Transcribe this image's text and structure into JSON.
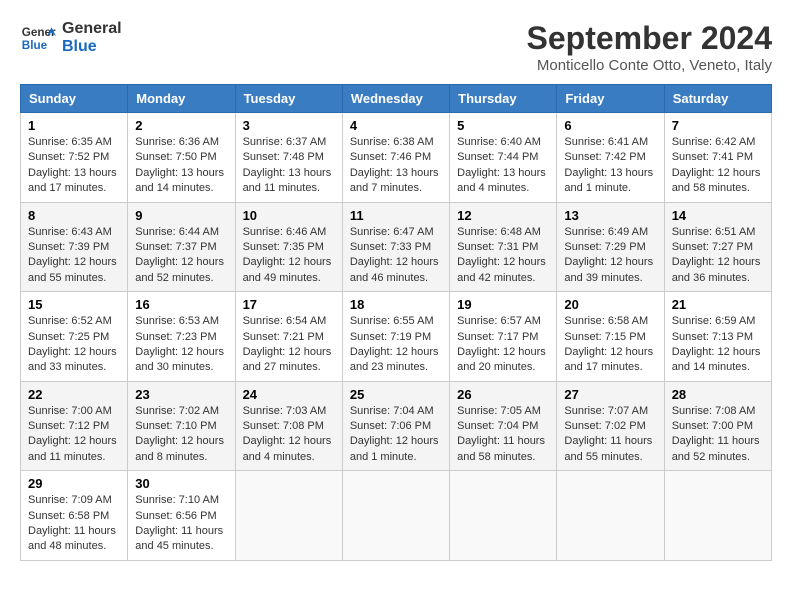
{
  "header": {
    "logo_line1": "General",
    "logo_line2": "Blue",
    "month": "September 2024",
    "location": "Monticello Conte Otto, Veneto, Italy"
  },
  "days_of_week": [
    "Sunday",
    "Monday",
    "Tuesday",
    "Wednesday",
    "Thursday",
    "Friday",
    "Saturday"
  ],
  "weeks": [
    [
      {
        "day": "1",
        "info": "Sunrise: 6:35 AM\nSunset: 7:52 PM\nDaylight: 13 hours and 17 minutes."
      },
      {
        "day": "2",
        "info": "Sunrise: 6:36 AM\nSunset: 7:50 PM\nDaylight: 13 hours and 14 minutes."
      },
      {
        "day": "3",
        "info": "Sunrise: 6:37 AM\nSunset: 7:48 PM\nDaylight: 13 hours and 11 minutes."
      },
      {
        "day": "4",
        "info": "Sunrise: 6:38 AM\nSunset: 7:46 PM\nDaylight: 13 hours and 7 minutes."
      },
      {
        "day": "5",
        "info": "Sunrise: 6:40 AM\nSunset: 7:44 PM\nDaylight: 13 hours and 4 minutes."
      },
      {
        "day": "6",
        "info": "Sunrise: 6:41 AM\nSunset: 7:42 PM\nDaylight: 13 hours and 1 minute."
      },
      {
        "day": "7",
        "info": "Sunrise: 6:42 AM\nSunset: 7:41 PM\nDaylight: 12 hours and 58 minutes."
      }
    ],
    [
      {
        "day": "8",
        "info": "Sunrise: 6:43 AM\nSunset: 7:39 PM\nDaylight: 12 hours and 55 minutes."
      },
      {
        "day": "9",
        "info": "Sunrise: 6:44 AM\nSunset: 7:37 PM\nDaylight: 12 hours and 52 minutes."
      },
      {
        "day": "10",
        "info": "Sunrise: 6:46 AM\nSunset: 7:35 PM\nDaylight: 12 hours and 49 minutes."
      },
      {
        "day": "11",
        "info": "Sunrise: 6:47 AM\nSunset: 7:33 PM\nDaylight: 12 hours and 46 minutes."
      },
      {
        "day": "12",
        "info": "Sunrise: 6:48 AM\nSunset: 7:31 PM\nDaylight: 12 hours and 42 minutes."
      },
      {
        "day": "13",
        "info": "Sunrise: 6:49 AM\nSunset: 7:29 PM\nDaylight: 12 hours and 39 minutes."
      },
      {
        "day": "14",
        "info": "Sunrise: 6:51 AM\nSunset: 7:27 PM\nDaylight: 12 hours and 36 minutes."
      }
    ],
    [
      {
        "day": "15",
        "info": "Sunrise: 6:52 AM\nSunset: 7:25 PM\nDaylight: 12 hours and 33 minutes."
      },
      {
        "day": "16",
        "info": "Sunrise: 6:53 AM\nSunset: 7:23 PM\nDaylight: 12 hours and 30 minutes."
      },
      {
        "day": "17",
        "info": "Sunrise: 6:54 AM\nSunset: 7:21 PM\nDaylight: 12 hours and 27 minutes."
      },
      {
        "day": "18",
        "info": "Sunrise: 6:55 AM\nSunset: 7:19 PM\nDaylight: 12 hours and 23 minutes."
      },
      {
        "day": "19",
        "info": "Sunrise: 6:57 AM\nSunset: 7:17 PM\nDaylight: 12 hours and 20 minutes."
      },
      {
        "day": "20",
        "info": "Sunrise: 6:58 AM\nSunset: 7:15 PM\nDaylight: 12 hours and 17 minutes."
      },
      {
        "day": "21",
        "info": "Sunrise: 6:59 AM\nSunset: 7:13 PM\nDaylight: 12 hours and 14 minutes."
      }
    ],
    [
      {
        "day": "22",
        "info": "Sunrise: 7:00 AM\nSunset: 7:12 PM\nDaylight: 12 hours and 11 minutes."
      },
      {
        "day": "23",
        "info": "Sunrise: 7:02 AM\nSunset: 7:10 PM\nDaylight: 12 hours and 8 minutes."
      },
      {
        "day": "24",
        "info": "Sunrise: 7:03 AM\nSunset: 7:08 PM\nDaylight: 12 hours and 4 minutes."
      },
      {
        "day": "25",
        "info": "Sunrise: 7:04 AM\nSunset: 7:06 PM\nDaylight: 12 hours and 1 minute."
      },
      {
        "day": "26",
        "info": "Sunrise: 7:05 AM\nSunset: 7:04 PM\nDaylight: 11 hours and 58 minutes."
      },
      {
        "day": "27",
        "info": "Sunrise: 7:07 AM\nSunset: 7:02 PM\nDaylight: 11 hours and 55 minutes."
      },
      {
        "day": "28",
        "info": "Sunrise: 7:08 AM\nSunset: 7:00 PM\nDaylight: 11 hours and 52 minutes."
      }
    ],
    [
      {
        "day": "29",
        "info": "Sunrise: 7:09 AM\nSunset: 6:58 PM\nDaylight: 11 hours and 48 minutes."
      },
      {
        "day": "30",
        "info": "Sunrise: 7:10 AM\nSunset: 6:56 PM\nDaylight: 11 hours and 45 minutes."
      },
      {
        "day": "",
        "info": ""
      },
      {
        "day": "",
        "info": ""
      },
      {
        "day": "",
        "info": ""
      },
      {
        "day": "",
        "info": ""
      },
      {
        "day": "",
        "info": ""
      }
    ]
  ]
}
